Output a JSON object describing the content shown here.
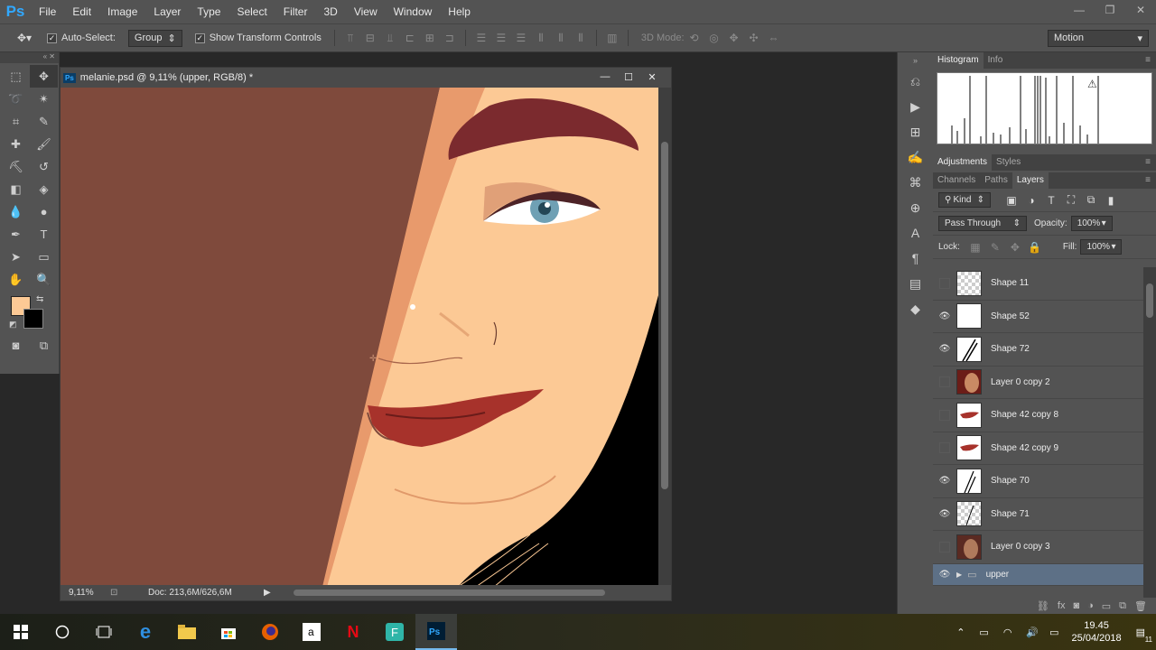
{
  "app": {
    "logo": "Ps"
  },
  "menu": [
    "File",
    "Edit",
    "Image",
    "Layer",
    "Type",
    "Select",
    "Filter",
    "3D",
    "View",
    "Window",
    "Help"
  ],
  "window_controls": {
    "minimize": "—",
    "restore": "❐",
    "close": "✕"
  },
  "options": {
    "auto_select_label": "Auto-Select:",
    "auto_select_value": "Group",
    "transform_label": "Show Transform Controls",
    "mode3d_label": "3D Mode:",
    "workspace": "Motion"
  },
  "document": {
    "title": "melanie.psd @ 9,11% (upper, RGB/8) *",
    "icon": "Ps",
    "zoom": "9,11%",
    "doc_info": "Doc: 213,6M/626,6M"
  },
  "colors": {
    "foreground": "#fcc995",
    "background": "#000000"
  },
  "panels": {
    "histogram_tab": "Histogram",
    "info_tab": "Info",
    "adjustments_tab": "Adjustments",
    "styles_tab": "Styles",
    "channels_tab": "Channels",
    "paths_tab": "Paths",
    "layers_tab": "Layers"
  },
  "layers_panel": {
    "filter_kind": "Kind",
    "blend_mode": "Pass Through",
    "opacity_label": "Opacity:",
    "opacity": "100%",
    "lock_label": "Lock:",
    "fill_label": "Fill:",
    "fill": "100%"
  },
  "layers": [
    {
      "name": "Shape 11",
      "visible": false,
      "thumb": "check"
    },
    {
      "name": "Shape 52",
      "visible": true,
      "thumb": "white"
    },
    {
      "name": "Shape 72",
      "visible": true,
      "thumb": "lines"
    },
    {
      "name": "Layer 0 copy 2",
      "visible": false,
      "thumb": "photo"
    },
    {
      "name": "Shape 42 copy 8",
      "visible": false,
      "thumb": "lips"
    },
    {
      "name": "Shape 42 copy 9",
      "visible": false,
      "thumb": "lips"
    },
    {
      "name": "Shape 70",
      "visible": true,
      "thumb": "lines"
    },
    {
      "name": "Shape 71",
      "visible": true,
      "thumb": "check"
    },
    {
      "name": "Layer 0 copy 3",
      "visible": false,
      "thumb": "photo"
    },
    {
      "name": "upper",
      "visible": true,
      "thumb": "folder",
      "selected": true
    }
  ],
  "taskbar": {
    "time": "19.45",
    "date": "25/04/2018",
    "notifications": "11"
  }
}
